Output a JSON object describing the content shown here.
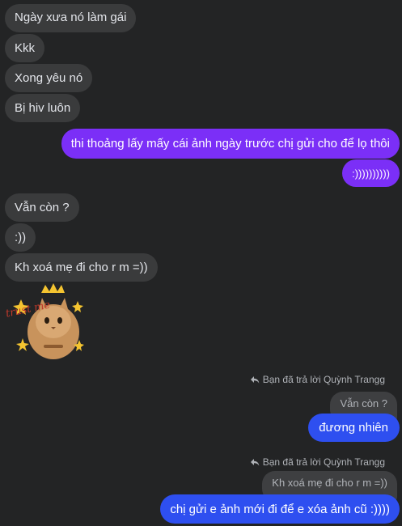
{
  "thread": {
    "incoming_1": "Ngày xưa nó làm gái",
    "incoming_2": "Kkk",
    "incoming_3": "Xong yêu nó",
    "incoming_4": "Bị hiv luôn",
    "outgoing_1": "thi thoảng lấy mấy cái ảnh ngày trước chị gửi cho để lọ thôi",
    "outgoing_2": ":))))))))))",
    "incoming_5": "Vẫn còn ?",
    "incoming_6": ":))",
    "incoming_7": "Kh xoá mẹ đi cho r m =))",
    "sticker_text": "trust me",
    "reply_note_1": "Bạn đã trả lời Quỳnh Trangg",
    "quoted_1": "Vẫn còn ?",
    "outgoing_3": "đương nhiên",
    "reply_note_2": "Bạn đã trả lời Quỳnh Trangg",
    "quoted_2": "Kh xoá mẹ đi cho r m =))",
    "outgoing_4": "chị gửi e ảnh mới đi để e xóa ảnh cũ :))))"
  },
  "colors": {
    "background": "#232425",
    "incoming_bubble": "#3a3b3c",
    "outgoing_purple": "#7b2ff7",
    "outgoing_blue": "#2e4ff0"
  },
  "icons": {
    "reply": "reply-arrow-icon",
    "sticker": "cat-crown-sticker"
  }
}
